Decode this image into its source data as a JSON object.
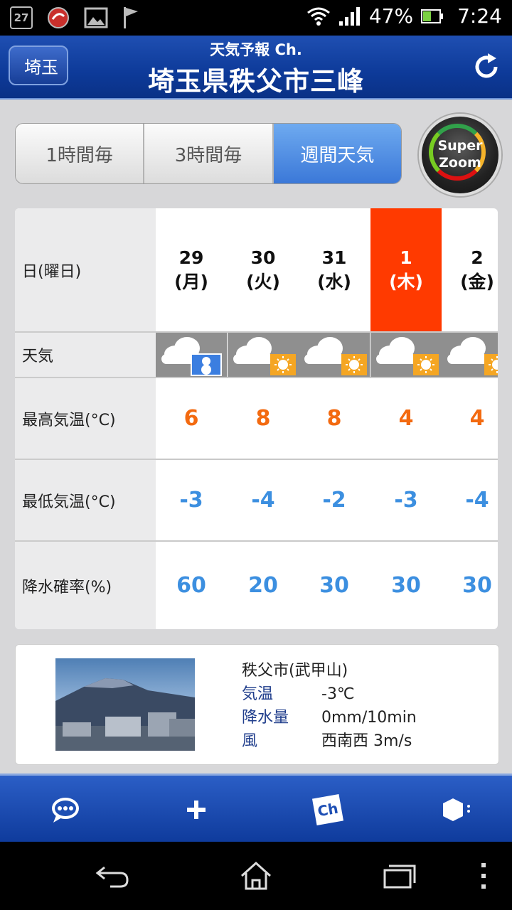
{
  "statusbar": {
    "badge": "27",
    "battery": "47%",
    "time": "7:24",
    "icons": [
      "notification-27-icon",
      "app-notification-icon",
      "image-icon",
      "flag-icon",
      "wifi-icon",
      "signal-icon",
      "battery-icon"
    ]
  },
  "header": {
    "back_label": "埼玉",
    "app_subtitle": "天気予報 Ch.",
    "title": "埼玉県秩父市三峰"
  },
  "tabs": [
    {
      "label": "1時間毎",
      "active": false
    },
    {
      "label": "3時間毎",
      "active": false
    },
    {
      "label": "週間天気",
      "active": true
    }
  ],
  "super_zoom": {
    "line1": "Super",
    "line2": "Zoom"
  },
  "forecast": {
    "labels": {
      "day": "日(曜日)",
      "weather": "天気",
      "high": "最高気温(°C)",
      "low": "最低気温(°C)",
      "precip": "降水確率(%)"
    },
    "days": [
      {
        "date": "29",
        "weekday": "(月)",
        "today": false,
        "weather": "cloudy-snow",
        "high": "6",
        "low": "-3",
        "precip": "60"
      },
      {
        "date": "30",
        "weekday": "(火)",
        "today": false,
        "weather": "cloudy-sunny",
        "high": "8",
        "low": "-4",
        "precip": "20"
      },
      {
        "date": "31",
        "weekday": "(水)",
        "today": false,
        "weather": "cloudy-sunny",
        "high": "8",
        "low": "-2",
        "precip": "30"
      },
      {
        "date": "1",
        "weekday": "(木)",
        "today": true,
        "weather": "cloudy-sunny",
        "high": "4",
        "low": "-3",
        "precip": "30"
      },
      {
        "date": "2",
        "weekday": "(金)",
        "today": false,
        "weather": "cloudy-sunny",
        "high": "4",
        "low": "-4",
        "precip": "30"
      }
    ]
  },
  "observation": {
    "location": "秩父市(武甲山)",
    "temp_label": "気温",
    "temp_value": "-3℃",
    "rain_label": "降水量",
    "rain_value": "0mm/10min",
    "wind_label": "風",
    "wind_value": "西南西 3m/s"
  },
  "toolbar": {
    "icons": [
      "chat-icon",
      "add-icon",
      "channel-icon",
      "menu-icon"
    ],
    "ch_label": "Ch"
  },
  "colors": {
    "header_blue": "#0d3a99",
    "today_red": "#ff3a00",
    "high_orange": "#f36a10",
    "low_blue": "#3c8fe0",
    "tab_active": "#3b78d8"
  }
}
